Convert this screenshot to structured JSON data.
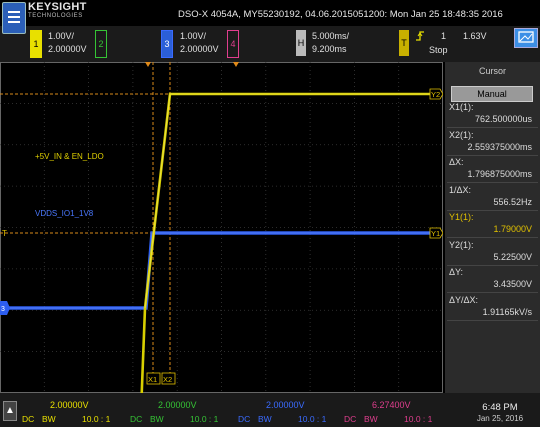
{
  "brand": {
    "name": "KEYSIGHT",
    "sub": "TECHNOLOGIES"
  },
  "title": "DSO-X 4054A, MY55230192, 04.06.2015051200: Mon Jan 25 18:48:35 2016",
  "channels": [
    {
      "num": "1",
      "scale": "1.00V/",
      "offset": "2.00000V",
      "color": "#e8e000"
    },
    {
      "num": "2",
      "scale": "",
      "offset": "",
      "color": "#35c435"
    },
    {
      "num": "3",
      "scale": "1.00V/",
      "offset": "2.00000V",
      "color": "#3a6bff"
    },
    {
      "num": "4",
      "scale": "",
      "offset": "",
      "color": "#e03e8e"
    }
  ],
  "horizontal": {
    "label": "H",
    "scale": "5.000ms/",
    "delay": "9.200ms"
  },
  "trigger": {
    "label": "T",
    "source": "1",
    "level": "1.63V",
    "status": "Stop",
    "color": "#e8e000"
  },
  "waveform_labels": {
    "ch1": "+5V_IN & EN_LDO",
    "ch3": "VDDS_IO1_1V8"
  },
  "markers": {
    "y2": "Y2",
    "y1": "Y1",
    "x1": "X1",
    "x2": "X2",
    "trig": "T",
    "ch1": "1",
    "ch3": "3"
  },
  "cursor_panel": {
    "title": "Cursor",
    "mode": "Manual",
    "rows": [
      {
        "label": "X1(1):",
        "value": "762.500000us",
        "color": "#dddddd"
      },
      {
        "label": "X2(1):",
        "value": "2.559375000ms",
        "color": "#dddddd"
      },
      {
        "label": "ΔX:",
        "value": "1.796875000ms",
        "color": "#dddddd"
      },
      {
        "label": "1/ΔX:",
        "value": "556.52Hz",
        "color": "#dddddd"
      },
      {
        "label": "Y1(1):",
        "value": "1.79000V",
        "color": "#e0c000"
      },
      {
        "label": "Y2(1):",
        "value": "5.22500V",
        "color": "#dddddd"
      },
      {
        "label": "ΔY:",
        "value": "3.43500V",
        "color": "#dddddd"
      },
      {
        "label": "ΔY/ΔX:",
        "value": "1.91165kV/s",
        "color": "#dddddd"
      }
    ]
  },
  "bottom": [
    {
      "value": "2.00000V",
      "dc": "DC",
      "bw": "BW",
      "ratio": "10.0 : 1",
      "color": "#e8e000"
    },
    {
      "value": "2.00000V",
      "dc": "DC",
      "bw": "BW",
      "ratio": "10.0 : 1",
      "color": "#35c435"
    },
    {
      "value": "2.00000V",
      "dc": "DC",
      "bw": "BW",
      "ratio": "10.0 : 1",
      "color": "#3a6bff"
    },
    {
      "value": "6.27400V",
      "dc": "DC",
      "bw": "BW",
      "ratio": "10.0 : 1",
      "color": "#e03e8e"
    }
  ],
  "clock": {
    "time": "6:48 PM",
    "date": "Jan 25, 2016"
  },
  "icons": {
    "menu": "menu-icon",
    "softkey": "up-arrow-icon",
    "screen": "screen-icon",
    "trigger_edge": "rising-edge-icon"
  }
}
